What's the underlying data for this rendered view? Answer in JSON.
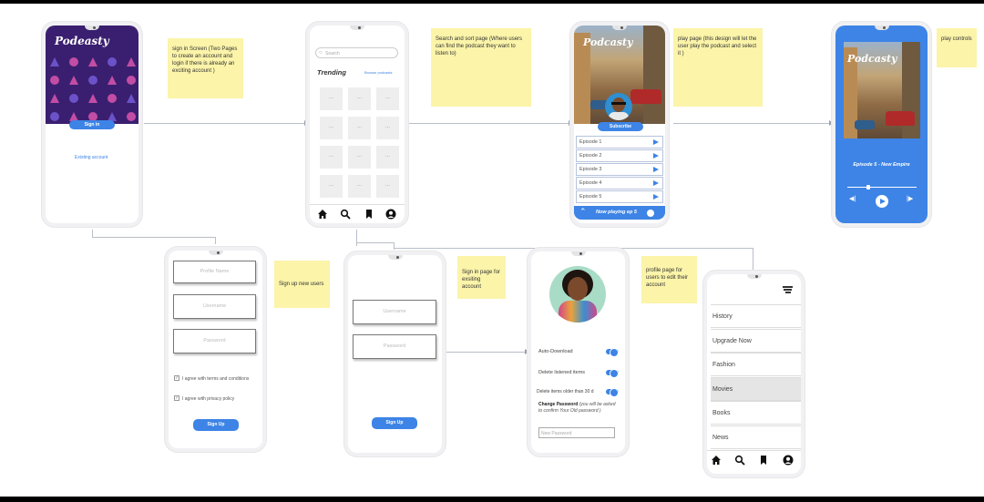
{
  "notes": {
    "signin": "sign in Screen (Two Pages to create an account and login if there is already  an exciting account )",
    "search": "Search and sort page (Where users can find the podcast they want to listen to)",
    "play": "play page (this design will let the user play the  podcast and select it )",
    "controls": "play controls",
    "signup": "Sign up new users",
    "signin_page": "Sign in page for exsiting account",
    "profile": "profile page for users to edit their account"
  },
  "screen1": {
    "logo": "Podeasty",
    "signin_btn": "Sign in",
    "link": "Existing account"
  },
  "screen2": {
    "search_placeholder": "Search",
    "heading": "Trending",
    "browse": "Browse podcasts",
    "cell": "..."
  },
  "screen3": {
    "logo": "Podcasty",
    "subscribe": "Subscribe",
    "episodes": [
      "Episode 1",
      "Episode 2",
      "Episode 3",
      "Episode 4",
      "Episode 5"
    ],
    "now_playing": "Now playing ep 5"
  },
  "screen4": {
    "logo": "Podcasty",
    "episode_title": "Episode 5 - New Empire"
  },
  "signup": {
    "fields": [
      "Profile Name",
      "Username",
      "Password"
    ],
    "terms": "I agree with terms and conditions",
    "privacy": "I agree with privacy policy",
    "btn": "Sign Up"
  },
  "signin": {
    "fields": [
      "Username",
      "Password"
    ],
    "btn": "Sign Up"
  },
  "profile": {
    "auto_download": "Auto-Download",
    "delete_listened": "Delete listened items",
    "delete_older": "Delete items older than 30 d",
    "change_pw_bold": "Change Password",
    "change_pw_rest": "(you will be asked to confirm Your Old password )",
    "new_pw_placeholder": "New Password"
  },
  "menu": {
    "items": [
      "History",
      "Upgrade Now",
      "Fashion",
      "Movies",
      "Books",
      "News"
    ],
    "selected": "Movies"
  },
  "colors": {
    "accent": "#3d84e6",
    "sticky": "#fbf4a9",
    "hero_dark": "#3a1f70"
  }
}
